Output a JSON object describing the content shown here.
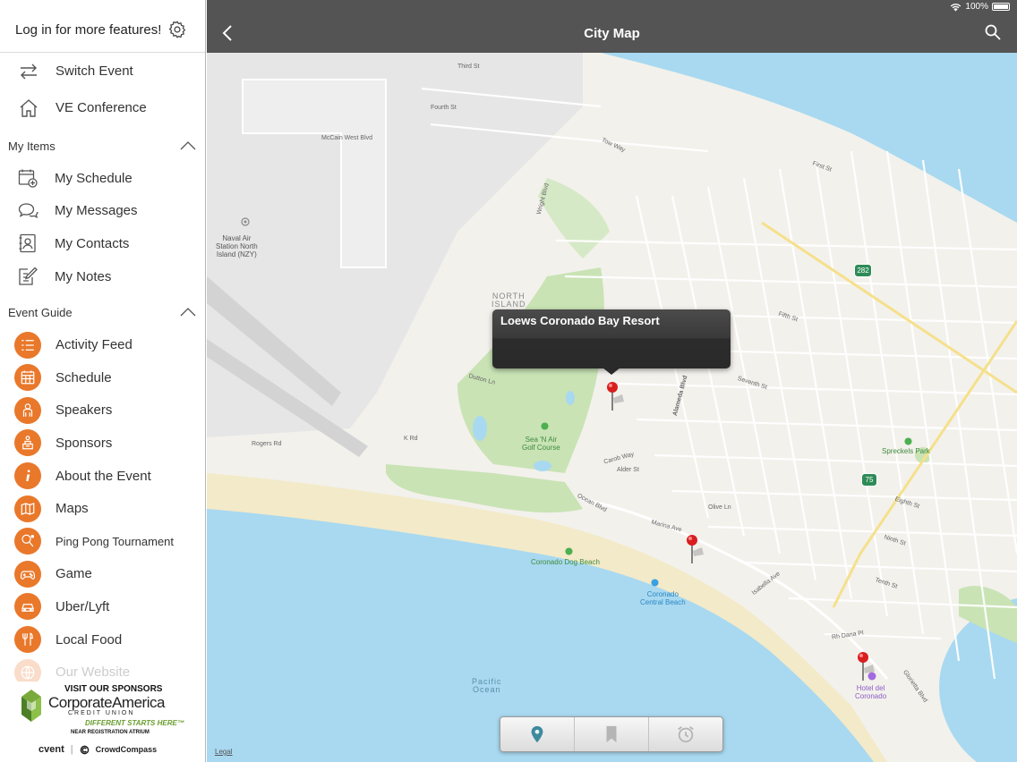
{
  "sidebar": {
    "login_text": "Log in for more features!",
    "top_items": [
      {
        "label": "Switch Event",
        "icon": "switch-arrows-icon"
      },
      {
        "label": "VE Conference",
        "icon": "home-icon"
      }
    ],
    "my_items": {
      "title": "My Items",
      "items": [
        {
          "label": "My Schedule",
          "icon": "calendar-add-icon"
        },
        {
          "label": "My Messages",
          "icon": "chat-bubbles-icon"
        },
        {
          "label": "My Contacts",
          "icon": "contact-card-icon"
        },
        {
          "label": "My Notes",
          "icon": "note-pencil-icon"
        }
      ]
    },
    "event_guide": {
      "title": "Event Guide",
      "items": [
        {
          "label": "Activity Feed",
          "icon": "feed-list-icon"
        },
        {
          "label": "Schedule",
          "icon": "calendar-grid-icon"
        },
        {
          "label": "Speakers",
          "icon": "speaker-icon"
        },
        {
          "label": "Sponsors",
          "icon": "sponsor-icon"
        },
        {
          "label": "About the Event",
          "icon": "info-icon"
        },
        {
          "label": "Maps",
          "icon": "map-icon"
        },
        {
          "label": "Ping Pong Tournament",
          "icon": "paddle-icon"
        },
        {
          "label": "Game",
          "icon": "gamepad-icon"
        },
        {
          "label": "Uber/Lyft",
          "icon": "car-icon"
        },
        {
          "label": "Local Food",
          "icon": "fork-knife-icon"
        },
        {
          "label": "Our Website",
          "icon": "globe-icon"
        }
      ]
    },
    "sponsor": {
      "headline": "VISIT OUR SPONSORS",
      "name": "CorporateAmerica",
      "sub": "CREDIT UNION",
      "tagline": "DIFFERENT STARTS HERE™",
      "location": "NEAR REGISTRATION ATRIUM",
      "footer_left": "cvent",
      "footer_sep": "|",
      "footer_right": "CrowdCompass"
    }
  },
  "navbar": {
    "title": "City Map",
    "battery": "100%"
  },
  "map": {
    "callout": "Loews Coronado Bay Resort",
    "legal": "Legal",
    "labels": {
      "naval_air": "Naval Air\nStation North\nIsland (NZY)",
      "north_island": "NORTH\nISLAND",
      "golf": "Sea 'N Air\nGolf Course",
      "dog_beach": "Coronado Dog Beach",
      "central_beach": "Coronado\nCentral Beach",
      "spreckels": "Spreckels Park",
      "pacific": "Pacific\nOcean",
      "hotel": "Hotel del\nCoronado",
      "hwy282": "282",
      "hwy75": "75",
      "third_st": "Third St",
      "fourth_st": "Fourth St",
      "mccain": "McCain West Blvd",
      "tow_way": "Tow Way",
      "first_st": "First St",
      "fifth_st": "Fifth St",
      "seventh_st": "Seventh St",
      "eighth_st": "Eighth St",
      "ninth_st": "Ninth St",
      "tenth_st": "Tenth St",
      "alameda": "Alameda Blvd",
      "ocean_blvd": "Ocean Blvd",
      "marina_ave": "Marina Ave",
      "olive_ln": "Olive Ln",
      "isabella": "Isabella Ave",
      "rh_dana": "Rh Dana Pl",
      "rogers_rd": "Rogers Rd",
      "k_rd": "K Rd",
      "carob": "Carob Way",
      "alder": "Alder St",
      "dutton": "Dutton Ln",
      "wright": "Wright Blvd",
      "glorietta": "Glorietta Blvd"
    }
  },
  "colors": {
    "accent": "#e9782b",
    "navbar": "#555454",
    "water": "#a8d9f0",
    "park": "#c9e3b5",
    "pin": "#d81e1e"
  }
}
